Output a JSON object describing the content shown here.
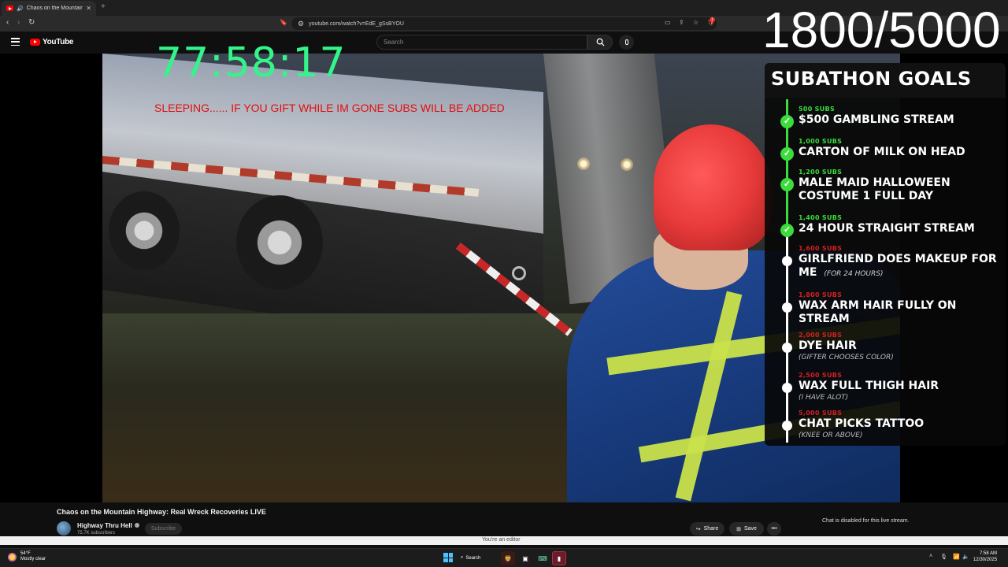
{
  "browser": {
    "tab_title": "Chaos on the Mountain High",
    "tab_audio_icon": "speaker-icon",
    "new_tab_label": "+",
    "url": "youtube.com/watch?v=EdE_gSsBYOU",
    "extension_badge": "1"
  },
  "youtube": {
    "logo_text": "YouTube",
    "search_placeholder": "Search"
  },
  "stream_overlay": {
    "timer": "77:58:17",
    "sleeping_notice": "SLEEPING......  IF YOU GIFT WHILE IM GONE SUBS WILL BE ADDED",
    "sub_counter": "1800/5000"
  },
  "goals_panel": {
    "title": "SUBATHON GOALS",
    "goals": [
      {
        "subs": "500 SUBS",
        "text": "$500 GAMBLING STREAM",
        "note": "",
        "done": true
      },
      {
        "subs": "1,000 SUBS",
        "text": "CARTON OF MILK ON HEAD",
        "note": "",
        "done": true
      },
      {
        "subs": "1,200 SUBS",
        "text": "MALE MAID HALLOWEEN COSTUME 1 FULL DAY",
        "note": "",
        "done": true
      },
      {
        "subs": "1,400 SUBS",
        "text": "24 HOUR STRAIGHT STREAM",
        "note": "",
        "done": true
      },
      {
        "subs": "1,600 SUBS",
        "text": "GIRLFRIEND DOES MAKEUP FOR ME",
        "note": "(FOR 24 HOURS)",
        "done": false
      },
      {
        "subs": "1,800 SUBS",
        "text": "WAX ARM HAIR FULLY ON STREAM",
        "note": "",
        "done": false
      },
      {
        "subs": "2,000 SUBS",
        "text": "DYE HAIR",
        "note": "(GIFTER CHOOSES COLOR)",
        "done": false
      },
      {
        "subs": "2,500 SUBS",
        "text": "WAX FULL THIGH HAIR",
        "note": "(I HAVE ALOT)",
        "done": false
      },
      {
        "subs": "5,000 SUBS",
        "text": "CHAT PICKS TATTOO",
        "note": "(KNEE OR ABOVE)",
        "done": false
      }
    ]
  },
  "video_info": {
    "title": "Chaos on the Mountain Highway: Real Wreck Recoveries LIVE",
    "channel_name": "Highway Thru Hell",
    "subscriber_count": "75.7K subscribers",
    "subscribe_label": "Subscribe",
    "share_label": "Share",
    "save_label": "Save",
    "more_label": "•••",
    "chat_disabled": "Chat is disabled for this live stream."
  },
  "editor_notice": "You're an editor",
  "taskbar": {
    "temperature": "54°F",
    "weather_text": "Mostly clear",
    "search_label": "Search",
    "time": "7:58 AM",
    "date": "12/30/2025"
  },
  "colors": {
    "timer_green": "#33f58a",
    "notice_red": "#e01010",
    "goal_done_green": "#3bdc3b",
    "goal_todo_red": "#d42020",
    "youtube_red": "#ff0000"
  }
}
